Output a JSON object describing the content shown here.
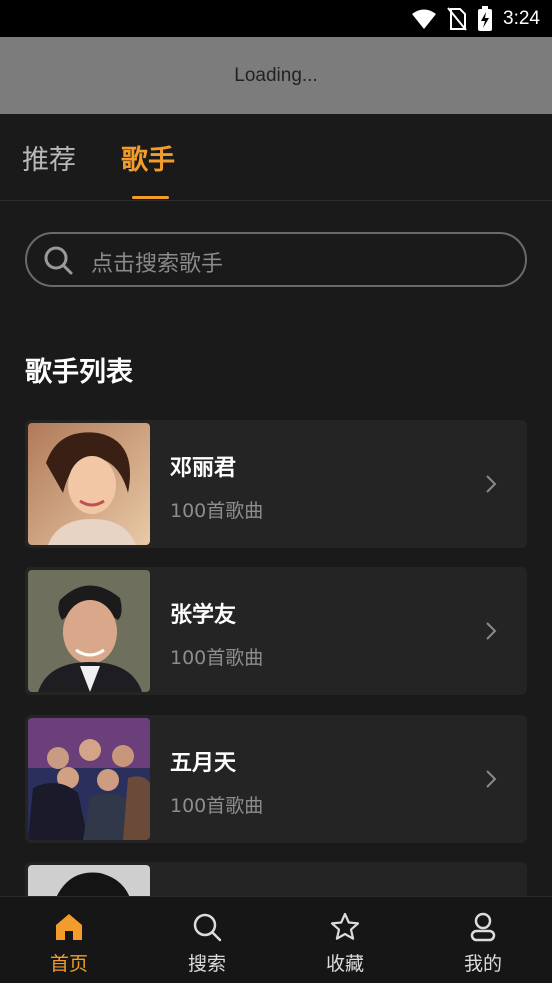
{
  "status_bar": {
    "time": "3:24"
  },
  "loading": {
    "text": "Loading..."
  },
  "tabs": [
    {
      "label": "推荐",
      "active": false
    },
    {
      "label": "歌手",
      "active": true
    }
  ],
  "search": {
    "placeholder": "点击搜索歌手"
  },
  "section": {
    "title": "歌手列表"
  },
  "singers": [
    {
      "name": "邓丽君",
      "count": "100首歌曲"
    },
    {
      "name": "张学友",
      "count": "100首歌曲"
    },
    {
      "name": "五月天",
      "count": "100首歌曲"
    },
    {
      "name": "",
      "count": ""
    }
  ],
  "nav": [
    {
      "label": "首页",
      "icon": "home-icon",
      "active": true
    },
    {
      "label": "搜索",
      "icon": "search-icon",
      "active": false
    },
    {
      "label": "收藏",
      "icon": "star-icon",
      "active": false
    },
    {
      "label": "我的",
      "icon": "user-icon",
      "active": false
    }
  ],
  "colors": {
    "accent": "#f39c2b",
    "background": "#1a1a1a",
    "card": "#242424"
  }
}
